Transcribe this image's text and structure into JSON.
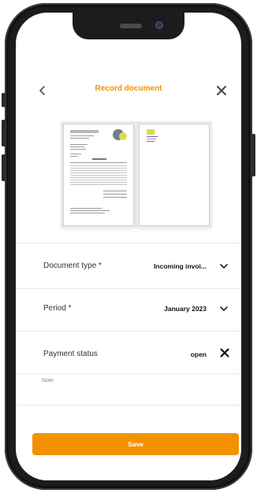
{
  "header": {
    "title": "Record document",
    "back_icon": "chevron-left-icon",
    "close_icon": "close-icon"
  },
  "form": {
    "document_type": {
      "label": "Document type *",
      "value": "Incoming invoi..."
    },
    "period": {
      "label": "Period *",
      "value": "January 2023"
    },
    "payment_status": {
      "label": "Payment status",
      "value": "open"
    },
    "note": {
      "placeholder": "Note"
    }
  },
  "actions": {
    "save_label": "Save"
  },
  "colors": {
    "accent": "#f39200",
    "phone_frame": "#1c1c1e"
  }
}
